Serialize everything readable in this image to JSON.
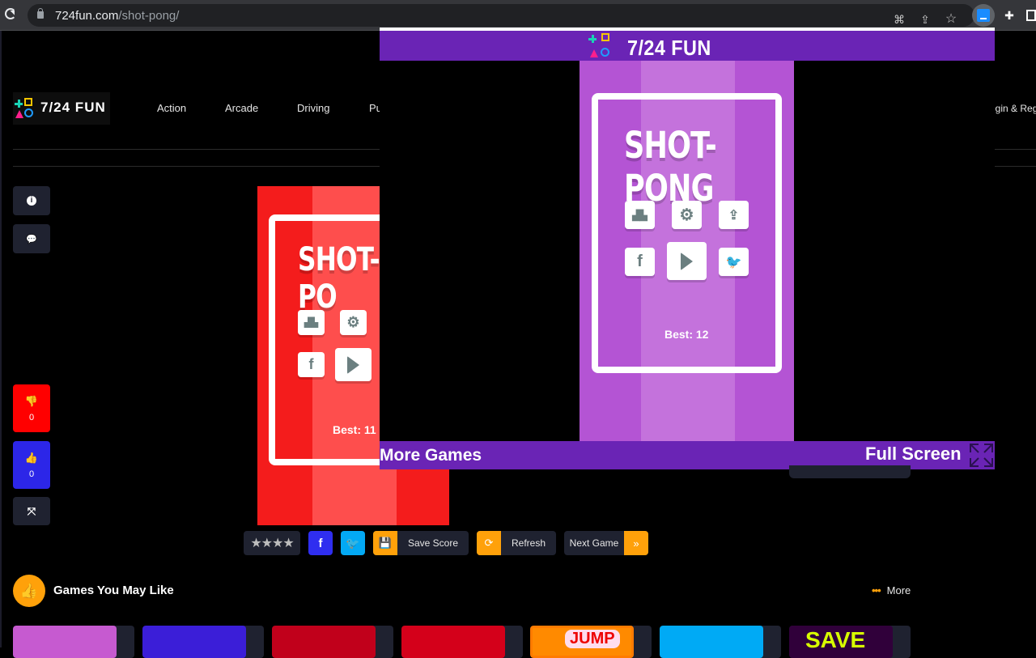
{
  "browser": {
    "url_domain": "724fun.com",
    "url_path": "/shot-pong/",
    "icons": [
      "reload-icon",
      "lock-icon",
      "translate-icon",
      "share-icon",
      "bookmark-star-icon",
      "extension-active-icon",
      "extensions-puzzle-icon",
      "sidebar-icon"
    ]
  },
  "site": {
    "logo_text": "7/24 FUN",
    "nav": [
      "Action",
      "Arcade",
      "Driving",
      "Pu"
    ],
    "login": "ogin & Reg"
  },
  "sidebar": {
    "info_icon": "info-icon",
    "comment_icon": "comment-icon",
    "dislike_count": "0",
    "like_count": "0",
    "fullscreen_icon": "expand-icon",
    "colors": {
      "dislike": "#ff0000",
      "like": "#2c26e8"
    }
  },
  "game_bg": {
    "title": "SHOT-PO",
    "best": "Best: 11",
    "colors": {
      "base": "#f41c1c",
      "stripe": "#fe4e4d"
    }
  },
  "overlay": {
    "header_title": "7/24 FUN",
    "more_games": "More Games",
    "full_screen": "Full Screen",
    "colors": {
      "bar": "#6a24b5",
      "game_base": "#b454d4",
      "game_stripe": "#c472dc"
    },
    "game": {
      "title": "SHOT-PONG",
      "best": "Best: 12",
      "buttons": [
        "leaderboard",
        "settings",
        "share",
        "facebook",
        "play",
        "twitter"
      ]
    }
  },
  "toolbar": {
    "rating_stars": 4,
    "rating_glyphs": "★★★★",
    "facebook_label": "f",
    "twitter_label": "🐦",
    "save_score": "Save Score",
    "refresh": "Refresh",
    "next_game": "Next Game",
    "next_icon": "»",
    "accent": "#ffa10a"
  },
  "recommended": {
    "title": "Games You May Like",
    "more": "More",
    "thumbs": [
      {
        "color": "#c65ad0"
      },
      {
        "color": "#3b1ed8"
      },
      {
        "color": "#c1001b"
      },
      {
        "color": "#d4001a"
      },
      {
        "color": "#ff8a00"
      },
      {
        "color": "#00aaf5"
      },
      {
        "color": "#30003a"
      }
    ],
    "visible_texts": [
      "JUMP",
      "SAVE"
    ]
  }
}
